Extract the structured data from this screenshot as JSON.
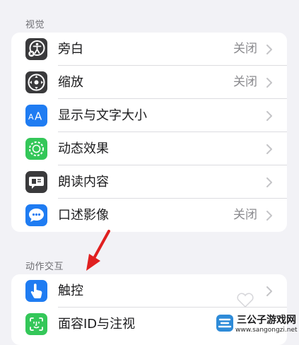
{
  "sections": [
    {
      "header": "视觉",
      "rows": [
        {
          "label": "旁白",
          "value": "关闭",
          "icon": "voiceover-icon"
        },
        {
          "label": "缩放",
          "value": "关闭",
          "icon": "zoom-icon"
        },
        {
          "label": "显示与文字大小",
          "value": "",
          "icon": "text-size-icon"
        },
        {
          "label": "动态效果",
          "value": "",
          "icon": "motion-icon"
        },
        {
          "label": "朗读内容",
          "value": "",
          "icon": "spoken-content-icon"
        },
        {
          "label": "口述影像",
          "value": "关闭",
          "icon": "audio-description-icon"
        }
      ]
    },
    {
      "header": "动作交互",
      "rows": [
        {
          "label": "触控",
          "value": "",
          "icon": "touch-icon"
        },
        {
          "label": "面容ID与注视",
          "value": "",
          "icon": "face-id-icon"
        }
      ]
    }
  ],
  "watermark": {
    "title": "三公子游戏网",
    "url": "www.sangongzi.net"
  },
  "colors": {
    "background": "#f2f2f6",
    "icon_dark": "#3a3a3c",
    "icon_blue": "#1f7cf2",
    "icon_green": "#34c759",
    "annotation_red": "#e02020"
  }
}
